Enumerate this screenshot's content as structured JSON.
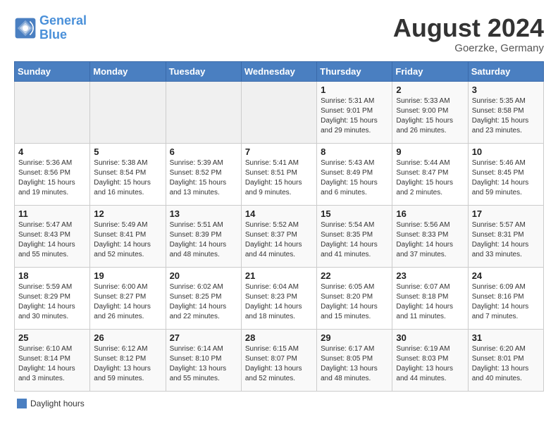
{
  "header": {
    "logo_line1": "General",
    "logo_line2": "Blue",
    "month": "August 2024",
    "location": "Goerzke, Germany"
  },
  "days_of_week": [
    "Sunday",
    "Monday",
    "Tuesday",
    "Wednesday",
    "Thursday",
    "Friday",
    "Saturday"
  ],
  "weeks": [
    [
      {
        "day": "",
        "info": ""
      },
      {
        "day": "",
        "info": ""
      },
      {
        "day": "",
        "info": ""
      },
      {
        "day": "",
        "info": ""
      },
      {
        "day": "1",
        "info": "Sunrise: 5:31 AM\nSunset: 9:01 PM\nDaylight: 15 hours\nand 29 minutes."
      },
      {
        "day": "2",
        "info": "Sunrise: 5:33 AM\nSunset: 9:00 PM\nDaylight: 15 hours\nand 26 minutes."
      },
      {
        "day": "3",
        "info": "Sunrise: 5:35 AM\nSunset: 8:58 PM\nDaylight: 15 hours\nand 23 minutes."
      }
    ],
    [
      {
        "day": "4",
        "info": "Sunrise: 5:36 AM\nSunset: 8:56 PM\nDaylight: 15 hours\nand 19 minutes."
      },
      {
        "day": "5",
        "info": "Sunrise: 5:38 AM\nSunset: 8:54 PM\nDaylight: 15 hours\nand 16 minutes."
      },
      {
        "day": "6",
        "info": "Sunrise: 5:39 AM\nSunset: 8:52 PM\nDaylight: 15 hours\nand 13 minutes."
      },
      {
        "day": "7",
        "info": "Sunrise: 5:41 AM\nSunset: 8:51 PM\nDaylight: 15 hours\nand 9 minutes."
      },
      {
        "day": "8",
        "info": "Sunrise: 5:43 AM\nSunset: 8:49 PM\nDaylight: 15 hours\nand 6 minutes."
      },
      {
        "day": "9",
        "info": "Sunrise: 5:44 AM\nSunset: 8:47 PM\nDaylight: 15 hours\nand 2 minutes."
      },
      {
        "day": "10",
        "info": "Sunrise: 5:46 AM\nSunset: 8:45 PM\nDaylight: 14 hours\nand 59 minutes."
      }
    ],
    [
      {
        "day": "11",
        "info": "Sunrise: 5:47 AM\nSunset: 8:43 PM\nDaylight: 14 hours\nand 55 minutes."
      },
      {
        "day": "12",
        "info": "Sunrise: 5:49 AM\nSunset: 8:41 PM\nDaylight: 14 hours\nand 52 minutes."
      },
      {
        "day": "13",
        "info": "Sunrise: 5:51 AM\nSunset: 8:39 PM\nDaylight: 14 hours\nand 48 minutes."
      },
      {
        "day": "14",
        "info": "Sunrise: 5:52 AM\nSunset: 8:37 PM\nDaylight: 14 hours\nand 44 minutes."
      },
      {
        "day": "15",
        "info": "Sunrise: 5:54 AM\nSunset: 8:35 PM\nDaylight: 14 hours\nand 41 minutes."
      },
      {
        "day": "16",
        "info": "Sunrise: 5:56 AM\nSunset: 8:33 PM\nDaylight: 14 hours\nand 37 minutes."
      },
      {
        "day": "17",
        "info": "Sunrise: 5:57 AM\nSunset: 8:31 PM\nDaylight: 14 hours\nand 33 minutes."
      }
    ],
    [
      {
        "day": "18",
        "info": "Sunrise: 5:59 AM\nSunset: 8:29 PM\nDaylight: 14 hours\nand 30 minutes."
      },
      {
        "day": "19",
        "info": "Sunrise: 6:00 AM\nSunset: 8:27 PM\nDaylight: 14 hours\nand 26 minutes."
      },
      {
        "day": "20",
        "info": "Sunrise: 6:02 AM\nSunset: 8:25 PM\nDaylight: 14 hours\nand 22 minutes."
      },
      {
        "day": "21",
        "info": "Sunrise: 6:04 AM\nSunset: 8:23 PM\nDaylight: 14 hours\nand 18 minutes."
      },
      {
        "day": "22",
        "info": "Sunrise: 6:05 AM\nSunset: 8:20 PM\nDaylight: 14 hours\nand 15 minutes."
      },
      {
        "day": "23",
        "info": "Sunrise: 6:07 AM\nSunset: 8:18 PM\nDaylight: 14 hours\nand 11 minutes."
      },
      {
        "day": "24",
        "info": "Sunrise: 6:09 AM\nSunset: 8:16 PM\nDaylight: 14 hours\nand 7 minutes."
      }
    ],
    [
      {
        "day": "25",
        "info": "Sunrise: 6:10 AM\nSunset: 8:14 PM\nDaylight: 14 hours\nand 3 minutes."
      },
      {
        "day": "26",
        "info": "Sunrise: 6:12 AM\nSunset: 8:12 PM\nDaylight: 13 hours\nand 59 minutes."
      },
      {
        "day": "27",
        "info": "Sunrise: 6:14 AM\nSunset: 8:10 PM\nDaylight: 13 hours\nand 55 minutes."
      },
      {
        "day": "28",
        "info": "Sunrise: 6:15 AM\nSunset: 8:07 PM\nDaylight: 13 hours\nand 52 minutes."
      },
      {
        "day": "29",
        "info": "Sunrise: 6:17 AM\nSunset: 8:05 PM\nDaylight: 13 hours\nand 48 minutes."
      },
      {
        "day": "30",
        "info": "Sunrise: 6:19 AM\nSunset: 8:03 PM\nDaylight: 13 hours\nand 44 minutes."
      },
      {
        "day": "31",
        "info": "Sunrise: 6:20 AM\nSunset: 8:01 PM\nDaylight: 13 hours\nand 40 minutes."
      }
    ]
  ],
  "legend": {
    "daylight_label": "Daylight hours"
  }
}
